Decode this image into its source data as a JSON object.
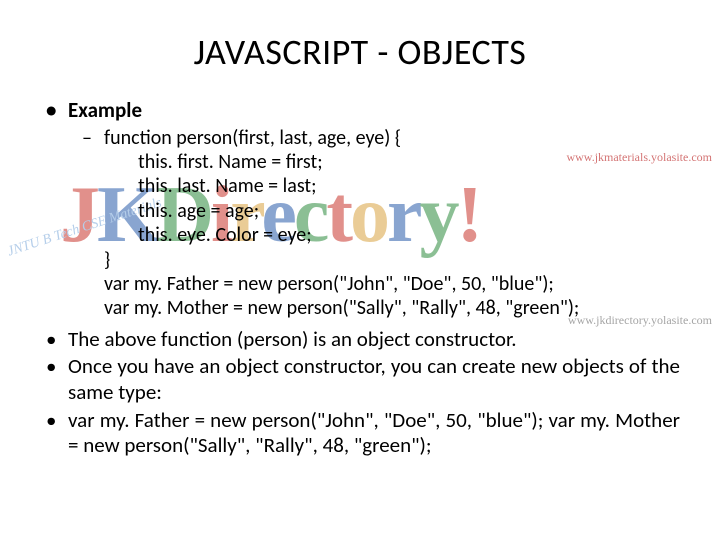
{
  "title": "JAVASCRIPT - OBJECTS",
  "example_label": "Example",
  "code": {
    "fn_open": "function person(first, last, age, eye) {",
    "l1": "this. first. Name = first;",
    "l2": "this. last. Name = last;",
    "l3": "this. age = age;",
    "l4": "this. eye. Color = eye;",
    "fn_close": "}",
    "v1": "var my. Father = new person(\"John\", \"Doe\", 50, \"blue\");",
    "v2": "var my. Mother = new person(\"Sally\", \"Rally\", 48, \"green\");"
  },
  "bullets": {
    "b1": "The above function (person) is an object constructor.",
    "b2": "Once you have an object constructor, you can create new objects of the same type:",
    "b3": "var my. Father = new person(\"John\", \"Doe\", 50, \"blue\"); var my. Mother = new person(\"Sally\", \"Rally\", 48, \"green\");"
  },
  "watermark": {
    "url_top": "www.jkmaterials.yolasite.com",
    "logo_text": "JKDirectory!",
    "side_text": "JNTU B Tech CSE Materials",
    "url_bottom": "www.jkdirectory.yolasite.com"
  }
}
